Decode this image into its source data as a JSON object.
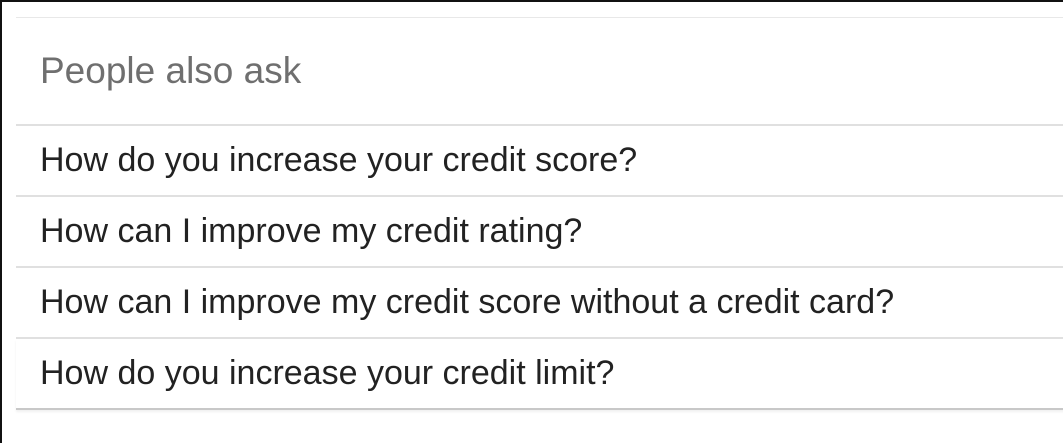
{
  "people_also_ask": {
    "heading": "People also ask",
    "questions": [
      "How do you increase your credit score?",
      "How can I improve my credit rating?",
      "How can I improve my credit score without a credit card?",
      "How do you increase your credit limit?"
    ]
  }
}
